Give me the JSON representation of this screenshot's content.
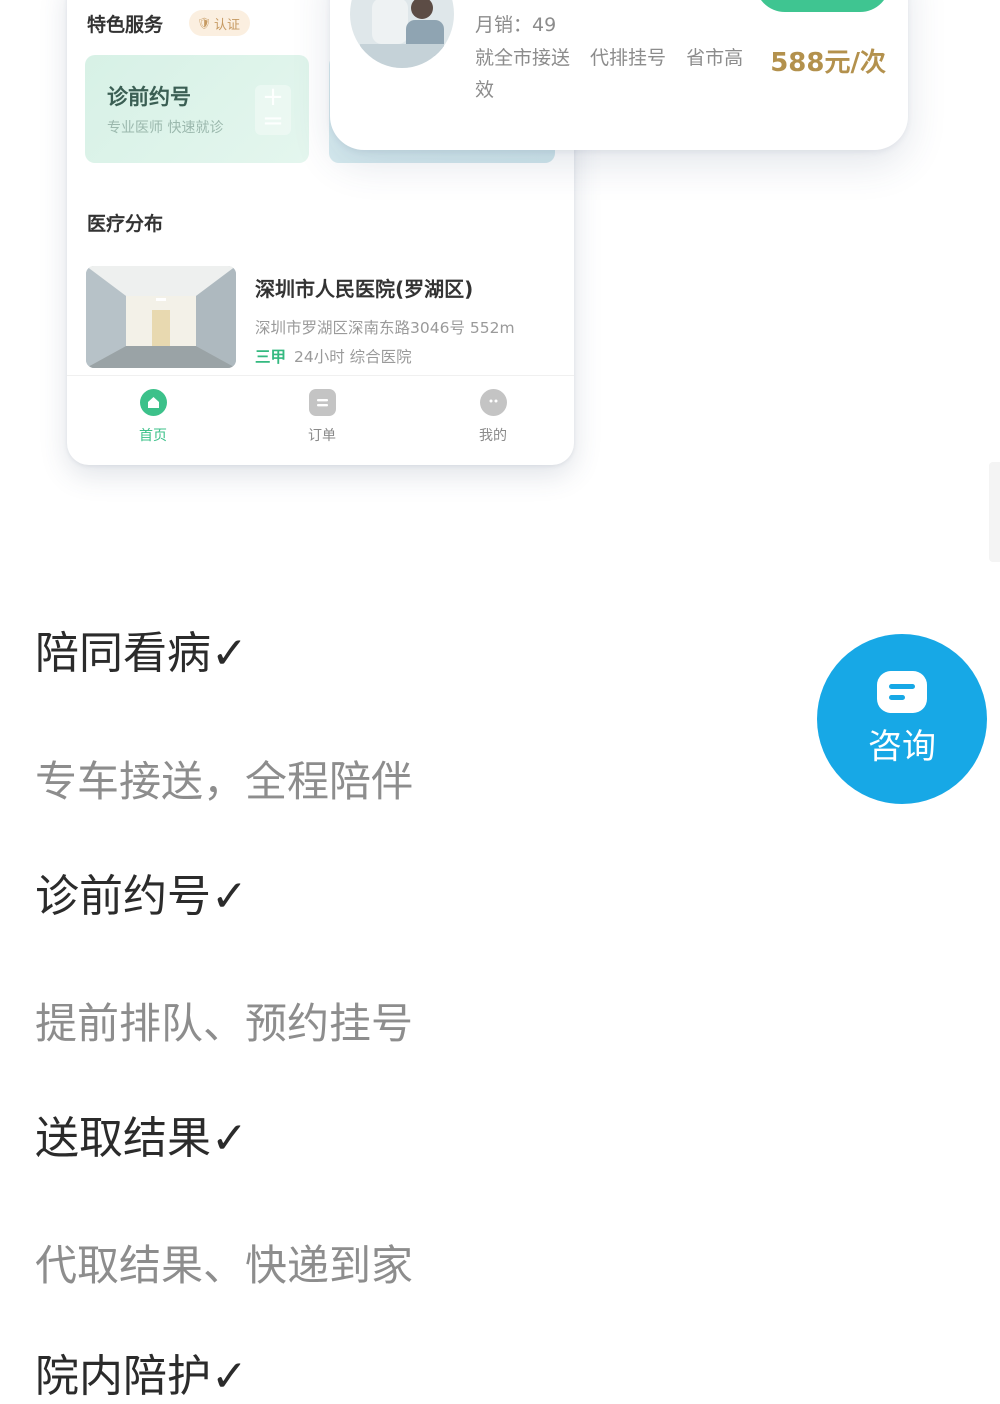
{
  "phone": {
    "section_title": "特色服务",
    "badge": "认证",
    "service_card": {
      "title": "诊前约号",
      "subtitle": "专业医师 快速就诊"
    },
    "distribution_title": "医疗分布",
    "hospital": {
      "name": "深圳市人民医院(罗湖区)",
      "address": "深圳市罗湖区深南东路3046号 552m",
      "level": "三甲",
      "tags": "24小时 综合医院"
    },
    "tabs": [
      {
        "label": "首页",
        "icon": "home-icon"
      },
      {
        "label": "订单",
        "icon": "order-icon"
      },
      {
        "label": "我的",
        "icon": "profile-icon"
      }
    ]
  },
  "product": {
    "sales": "月销：49",
    "desc": "就全市接送 代排挂号 省市高效",
    "price": "588元/次"
  },
  "features": [
    {
      "title": "陪同看病✓",
      "desc": "专车接送，全程陪伴"
    },
    {
      "title": "诊前约号✓",
      "desc": "提前排队、预约挂号"
    },
    {
      "title": "送取结果✓",
      "desc": "代取结果、快递到家"
    },
    {
      "title": "院内陪护✓"
    }
  ],
  "consult": {
    "label": "咨询",
    "icon": "chat-icon"
  },
  "colors": {
    "accent_green": "#3cc18a",
    "price_gold": "#b3914d",
    "fab_blue": "#17a8e6"
  }
}
